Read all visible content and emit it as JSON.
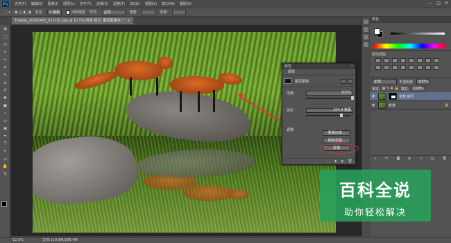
{
  "app": {
    "logo": "Ps"
  },
  "menus": [
    "文件(F)",
    "编辑(E)",
    "图像(I)",
    "图层(L)",
    "文字(Y)",
    "选择(S)",
    "滤镜(T)",
    "3D(D)",
    "视图(V)",
    "窗口(W)",
    "帮助(H)"
  ],
  "window_controls": {
    "minimize": "—",
    "maximize": "□",
    "close": "✕"
  },
  "options_bar": {
    "feather_label": "羽化:",
    "feather_value": "0 像素",
    "antialias_label": "消除锯齿",
    "style_label": "样式:",
    "style_value": "正常",
    "width_label": "宽度:",
    "height_label": "高度:"
  },
  "document_tab": {
    "title": "1fsacai_20160420_011101.jpg @ 12.5%(背景 拷贝, 图层蒙版/8) *",
    "close": "×"
  },
  "tools": [
    "⬚",
    "✥",
    "⬭",
    "⌖",
    "✂",
    "⌗",
    "✎",
    "⌀",
    "✐",
    "♣",
    "▣",
    "⌁",
    "▱",
    "◉",
    "⬤",
    "✒",
    "T",
    "↖",
    "▭",
    "✋",
    "⚲"
  ],
  "properties_panel": {
    "header": "属性",
    "collapse": "»",
    "tab": "蒙版",
    "mask_label": "图层蒙版",
    "density_label": "浓度:",
    "density_value": "100%",
    "density_fraction": 1.0,
    "feather_label": "羽化:",
    "feather_value": "104.4 像素",
    "feather_fraction": 0.75,
    "adjust_label": "调整:",
    "btn_mask_edge": "蒙版边缘...",
    "btn_color_range": "颜色范围...",
    "btn_invert": "反相",
    "footer_icons": [
      "⬚",
      "◑",
      "◉",
      "🗑"
    ]
  },
  "dock": {
    "color_tab": "颜色",
    "adjust_title": "添加调整",
    "blend_mode": "正常",
    "opacity_label": "不透明度:",
    "opacity_value": "100%",
    "lock_label": "锁定:",
    "fill_label": "填充:",
    "fill_value": "100%",
    "layers": [
      {
        "name": "背景 拷贝",
        "active": true,
        "has_mask": true
      },
      {
        "name": "背景",
        "active": false,
        "has_mask": false,
        "locked": "🔒"
      }
    ],
    "footer_icons": [
      "⚭",
      "fx",
      "◙",
      "◐",
      "▭",
      "▤",
      "🗑"
    ]
  },
  "statusbar": {
    "zoom": "12.5%",
    "doc": "文档:119.8M/299.4M"
  },
  "watermark": {
    "line1": "百科全说",
    "line2": "助你轻松解决"
  },
  "colors": {
    "accent_red": "#e03434",
    "watermark_green": "#28a05a",
    "active_layer": "#5f6f8c"
  }
}
